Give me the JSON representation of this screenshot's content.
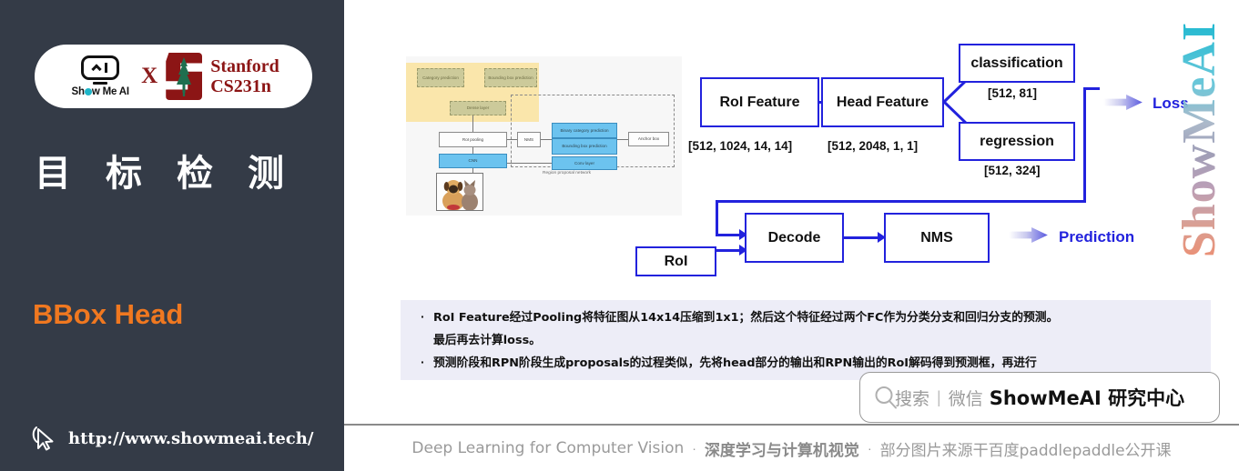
{
  "sidebar": {
    "logo": {
      "showmeai_wordmark": "Sh w Me AI",
      "cross": "X",
      "stanford_line1": "Stanford",
      "stanford_line2": "CS231n",
      "icon_showmeai": "showmeai-robot-icon",
      "icon_stanford": "stanford-tree-icon"
    },
    "title": "目标检测",
    "subtitle": "BBox Head",
    "url": "http://www.showmeai.tech/",
    "cursor_icon": "mouse-pointer-icon",
    "colors": {
      "background": "#343b47",
      "subtitle": "#f07820",
      "title": "#ffffff",
      "stanford_red": "#8C1515"
    }
  },
  "slide": {
    "reference_figure": {
      "caption": "Region proposal network",
      "nodes": [
        "Category prediction",
        "Bounding box prediction",
        "Dense layer",
        "RoI pooling",
        "CNN",
        "NMS",
        "Binary category prediction",
        "Bounding box prediction",
        "Anchor box",
        "Conv layer"
      ]
    },
    "flow": {
      "boxes": [
        {
          "label": "RoI Feature",
          "dim": "[512, 1024, 14, 14]"
        },
        {
          "label": "Head Feature",
          "dim": "[512, 2048, 1, 1]"
        },
        {
          "label": "classification",
          "dim": "[512, 81]"
        },
        {
          "label": "regression",
          "dim": "[512, 324]"
        },
        {
          "label": "RoI",
          "dim": ""
        },
        {
          "label": "Decode",
          "dim": ""
        },
        {
          "label": "NMS",
          "dim": ""
        }
      ],
      "outputs": [
        {
          "label": "Loss"
        },
        {
          "label": "Prediction"
        }
      ],
      "accent_color": "#2222dd"
    },
    "bullets": [
      {
        "line1": "RoI Feature经过Pooling将特征图从14x14压缩到1x1；然后这个特征经过两个FC作为分类分支和回归分支的预测。",
        "line2": "最后再去计算loss。"
      },
      {
        "line1": "预测阶段和RPN阶段生成proposals的过程类似，先将head部分的输出和RPN输出的RoI解码得到预测框，再进行",
        "line2": ""
      }
    ],
    "wechat": {
      "search_icon": "search-icon",
      "search_text": "搜索",
      "separator": "|",
      "channel": "微信",
      "account": "ShowMeAI 研究中心"
    },
    "footer": {
      "en": "Deep Learning for Computer Vision",
      "dot1": "·",
      "zh": "深度学习与计算机视觉",
      "dot2": "·",
      "source": "部分图片来源干百度paddlepaddle公开课"
    },
    "watermark": "ShowMeAI"
  }
}
